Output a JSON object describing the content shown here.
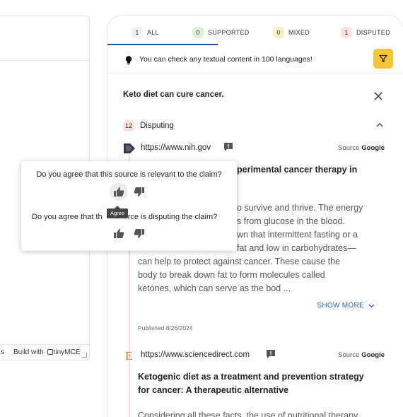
{
  "editor": {
    "footer_words": "s",
    "footer_built": "Build with",
    "footer_brand": "tinyMCE"
  },
  "tabs": [
    {
      "count": "1",
      "label": "ALL"
    },
    {
      "count": "0",
      "label": "SUPPORTED"
    },
    {
      "count": "0",
      "label": "MIXED"
    },
    {
      "count": "1",
      "label": "DISPUTED"
    }
  ],
  "info": {
    "text": "You can check any textual content in 100 languages!"
  },
  "claim": {
    "text": "Keto diet can cure cancer."
  },
  "group": {
    "count": "12",
    "label": "Disputing"
  },
  "sources": [
    {
      "url": "https://www.nih.gov",
      "source_label": "Source",
      "source_name": "Google",
      "title_visible": "perimental cancer therapy in",
      "body_lines": [
        "o survive and thrive. The energy",
        "s from glucose in the blood.",
        "wn that intermittent fasting or a",
        "fat and low in carbohydrates—",
        "can help to protect against cancer. These cause the",
        "body to break down fat to form molecules called",
        "ketones, which can serve as the bod ..."
      ],
      "show_more": "SHOW MORE",
      "published": "Published 8/26/2024"
    },
    {
      "url": "https://www.sciencedirect.com",
      "source_label": "Source",
      "source_name": "Google",
      "icon_letter": "E",
      "title_lines": [
        "Ketogenic diet as a treatment and prevention strategy",
        "for cancer: A therapeutic alternative"
      ],
      "body_partial": "Considering all these facts, the use of nutritional therapy"
    }
  ],
  "popup": {
    "q1": "Do you agree that this source is relevant to the claim?",
    "q2_left": "Do you agree that th",
    "q2_right": "rce is disputing the claim?",
    "tooltip": "Agree"
  },
  "colors": {
    "accent_blue": "#1b4fa8",
    "filter_yellow": "#f4c43b",
    "disputed_bg": "#fbe2de",
    "supported_bg": "#dff2d8",
    "mixed_bg": "#fbf0c4",
    "link_blue": "#2d63c4"
  },
  "icons": [
    "lightbulb-icon",
    "filter-icon",
    "close-icon",
    "chevron-up-icon",
    "chevron-down-icon",
    "nih-logo-icon",
    "elsevier-logo-icon",
    "report-flag-icon",
    "thumb-up-icon",
    "thumb-down-icon"
  ]
}
